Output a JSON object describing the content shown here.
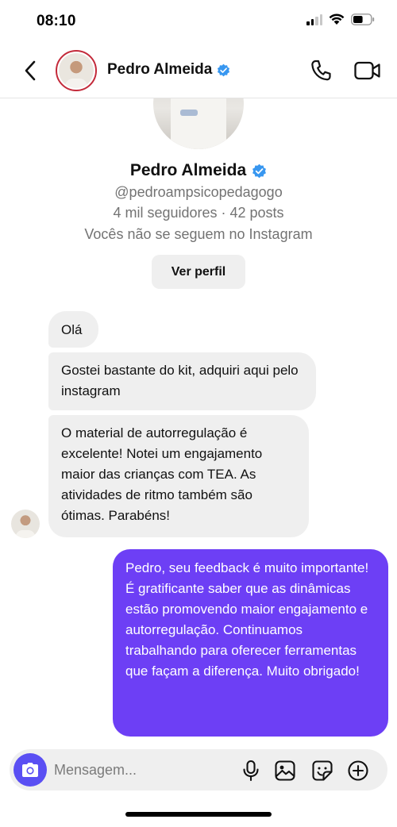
{
  "status_bar": {
    "time": "08:10",
    "battery_level_fraction": 0.55
  },
  "header": {
    "name": "Pedro Almeida",
    "verified": true
  },
  "profile": {
    "name": "Pedro Almeida",
    "handle": "@pedroampsicopedagogo",
    "stats": "4 mil seguidores · 42 posts",
    "follow_status": "Vocês não se seguem no Instagram",
    "view_profile_label": "Ver perfil"
  },
  "messages": [
    {
      "from": "them",
      "text": "Olá"
    },
    {
      "from": "them",
      "text": "Gostei bastante do kit, adquiri aqui pelo instagram"
    },
    {
      "from": "them",
      "text": "O material de autorregulação é excelente! Notei um engajamento maior das crianças com TEA. As atividades de ritmo também são ótimas. Parabéns!"
    },
    {
      "from": "me",
      "text": "Pedro, seu feedback é muito importante! É gratificante saber que as dinâmicas estão promovendo maior engajamento e autorregulação. Continuamos trabalhando para oferecer ferramentas que façam a diferença. Muito obrigado!"
    }
  ],
  "composer": {
    "placeholder": "Mensagem..."
  },
  "colors": {
    "outgoing_bubble": "#6d3ff5",
    "incoming_bubble": "#efefef",
    "camera_button": "#5a4ff3",
    "verified_badge": "#3897f0"
  }
}
